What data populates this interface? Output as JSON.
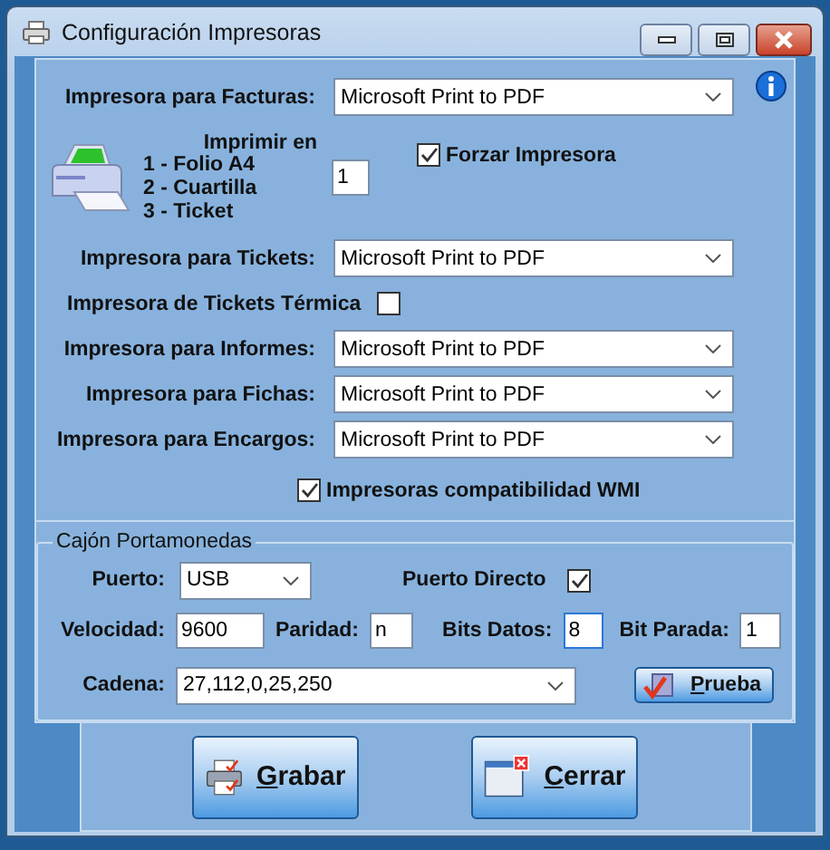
{
  "window": {
    "title": "Configuración Impresoras"
  },
  "printers": {
    "rows": [
      {
        "kind": "select",
        "label": "Impresora para Facturas:",
        "value": "Microsoft Print to PDF"
      },
      {
        "kind": "print_mode",
        "title": "Imprimir en",
        "options": [
          "1 - Folio A4",
          "2 - Cuartilla",
          "3 - Ticket"
        ],
        "value": "1",
        "force": {
          "label": "Forzar Impresora",
          "checked": true
        }
      },
      {
        "kind": "select",
        "label": "Impresora para Tickets:",
        "value": "Microsoft Print to PDF"
      },
      {
        "kind": "label_checkbox",
        "label": "Impresora de Tickets Térmica",
        "checked": false
      },
      {
        "kind": "select",
        "label": "Impresora para Informes:",
        "value": "Microsoft Print to PDF"
      },
      {
        "kind": "select",
        "label": "Impresora para Fichas:",
        "value": "Microsoft Print to PDF"
      },
      {
        "kind": "select",
        "label": "Impresora para Encargos:",
        "value": "Microsoft Print to PDF"
      },
      {
        "kind": "checkbox_label",
        "label": "Impresoras compatibilidad WMI",
        "checked": true
      }
    ]
  },
  "cash_drawer": {
    "title": "Cajón Portamonedas",
    "port": {
      "label": "Puerto:",
      "value": "USB"
    },
    "direct_port": {
      "label": "Puerto Directo",
      "checked": true
    },
    "fields": [
      {
        "label": "Velocidad:",
        "value": "9600",
        "focused": false
      },
      {
        "label": "Paridad:",
        "value": "n",
        "focused": false
      },
      {
        "label": "Bits Datos:",
        "value": "8",
        "focused": true
      },
      {
        "label": "Bit Parada:",
        "value": "1",
        "focused": false
      }
    ],
    "sequence": {
      "label": "Cadena:",
      "value": "27,112,0,25,250"
    },
    "test_button": {
      "label": "Prueba"
    }
  },
  "buttons": [
    {
      "kind": "save",
      "label": "Grabar"
    },
    {
      "kind": "close",
      "label": "Cerrar"
    }
  ]
}
